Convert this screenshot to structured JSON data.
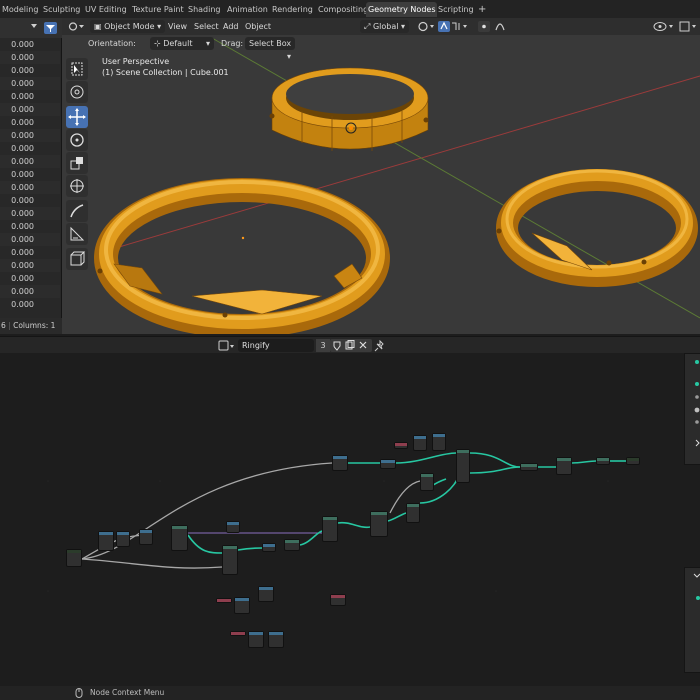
{
  "tabs": [
    {
      "label": "Modeling",
      "active": false
    },
    {
      "label": "Sculpting",
      "active": false
    },
    {
      "label": "UV Editing",
      "active": false
    },
    {
      "label": "Texture Paint",
      "active": false
    },
    {
      "label": "Shading",
      "active": false
    },
    {
      "label": "Animation",
      "active": false
    },
    {
      "label": "Rendering",
      "active": false
    },
    {
      "label": "Compositing",
      "active": false
    },
    {
      "label": "Geometry Nodes",
      "active": true
    },
    {
      "label": "Scripting",
      "active": false
    }
  ],
  "add_tab_label": "+",
  "spreadsheet": {
    "values": [
      "0.000",
      "0.000",
      "0.000",
      "0.000",
      "0.000",
      "0.000",
      "0.000",
      "0.000",
      "0.000",
      "0.000",
      "0.000",
      "0.000",
      "0.000",
      "0.000",
      "0.000",
      "0.000",
      "0.000",
      "0.000",
      "0.000",
      "0.000",
      "0.000"
    ],
    "footer_rows": "6",
    "footer_columns": "Columns: 1"
  },
  "viewport": {
    "mode_label": "Object Mode",
    "menu": [
      "View",
      "Select",
      "Add",
      "Object"
    ],
    "transform_label": "Global",
    "orientation_label": "Orientation:",
    "orientation_value": "Default",
    "drag_label": "Drag:",
    "drag_value": "Select Box",
    "perspective": "User Perspective",
    "collection": "(1) Scene Collection | Cube.001"
  },
  "node_editor": {
    "node_tree_name": "Ringify",
    "users_count": "3"
  },
  "status": {
    "context_menu": "Node Context Menu"
  },
  "colors": {
    "gold": "#e19c1d",
    "gold_dark": "#a9690b",
    "accent": "#4772b3",
    "link_teal": "#27c7a2",
    "link_gray": "#a8a8a8"
  }
}
